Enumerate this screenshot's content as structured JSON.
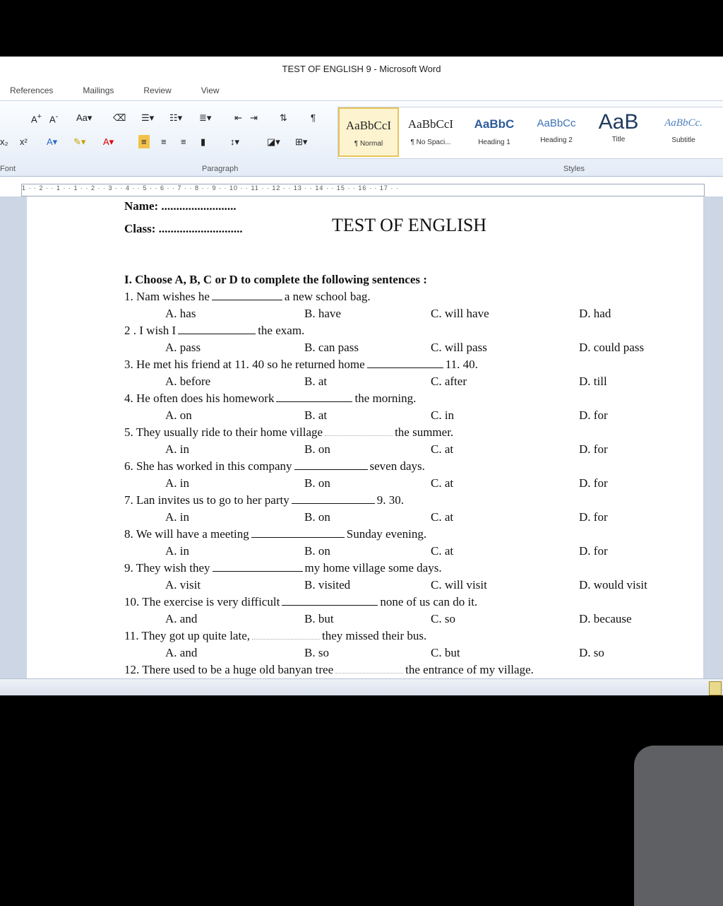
{
  "window": {
    "title": "TEST OF ENGLISH 9 - Microsoft Word"
  },
  "tabs": [
    "References",
    "Mailings",
    "Review",
    "View"
  ],
  "ribbon": {
    "font_group_label": "Font",
    "paragraph_group_label": "Paragraph",
    "styles_group_label": "Styles",
    "styles": [
      {
        "sample": "AaBbCcI",
        "name": "¶ Normal"
      },
      {
        "sample": "AaBbCcI",
        "name": "¶ No Spaci..."
      },
      {
        "sample": "AaBbC",
        "name": "Heading 1"
      },
      {
        "sample": "AaBbCc",
        "name": "Heading 2"
      },
      {
        "sample": "AaB",
        "name": "Title"
      },
      {
        "sample": "AaBbCc.",
        "name": "Subtitle"
      }
    ]
  },
  "ruler": {
    "text": "1 · · 2 · · 1 · · 1 · · 2 · · 3 · · 4 · · 5 · · 6 · · 7 · · 8 · · 9 · · 10 · · 11 · · 12 · · 13 · · 14 · · 15 · · 16 · · 17 · ·"
  },
  "document": {
    "name_line": "Name: .........................",
    "class_line": "Class: ............................",
    "title": "TEST OF ENGLISH",
    "section": "I. Choose A, B, C or D to complete the following sentences :",
    "questions": [
      {
        "pre": "1. Nam wishes he",
        "post": "a new school bag.",
        "options": [
          "A. has",
          "B. have",
          "C. will have",
          "D. had"
        ]
      },
      {
        "pre": "2 . I wish I",
        "post": "the exam.",
        "options": [
          "A. pass",
          "B. can pass",
          "C. will pass",
          "D. could pass"
        ]
      },
      {
        "pre": "3. He met his friend at 11. 40 so he returned home",
        "post": "11. 40.",
        "options": [
          "A. before",
          "B. at",
          "C. after",
          "D. till"
        ]
      },
      {
        "pre": "4. He often does his homework",
        "post": "the morning.",
        "options": [
          "A. on",
          "B. at",
          "C. in",
          "D. for"
        ]
      },
      {
        "pre": "5. They usually ride to their home village",
        "post": "the summer.",
        "options": [
          "A. in",
          "B. on",
          "C. at",
          "D. for"
        ]
      },
      {
        "pre": "6. She has worked in this company",
        "post": "seven days.",
        "options": [
          "A. in",
          "B. on",
          "C. at",
          "D. for"
        ]
      },
      {
        "pre": "7. Lan invites us to go to her party",
        "post": "9. 30.",
        "options": [
          "A. in",
          "B. on",
          "C. at",
          "D. for"
        ]
      },
      {
        "pre": "8. We will have a meeting",
        "post": "Sunday evening.",
        "options": [
          "A. in",
          "B. on",
          "C. at",
          "D. for"
        ]
      },
      {
        "pre": "9. They wish they",
        "post": "my home village some days.",
        "options": [
          "A. visit",
          "B. visited",
          "C. will visit",
          "D. would visit"
        ]
      },
      {
        "pre": "10. The exercise is very difficult",
        "post": "none of us can do it.",
        "options": [
          "A. and",
          "B. but",
          "C. so",
          "D. because"
        ]
      },
      {
        "pre": "11. They got up quite late,",
        "post": "they missed their bus.",
        "options": [
          "A. and",
          "B. so",
          "C. but",
          "D. so"
        ]
      },
      {
        "pre": "12. There used to be a huge old banyan tree",
        "post": "the entrance of my village.",
        "options": []
      }
    ]
  }
}
